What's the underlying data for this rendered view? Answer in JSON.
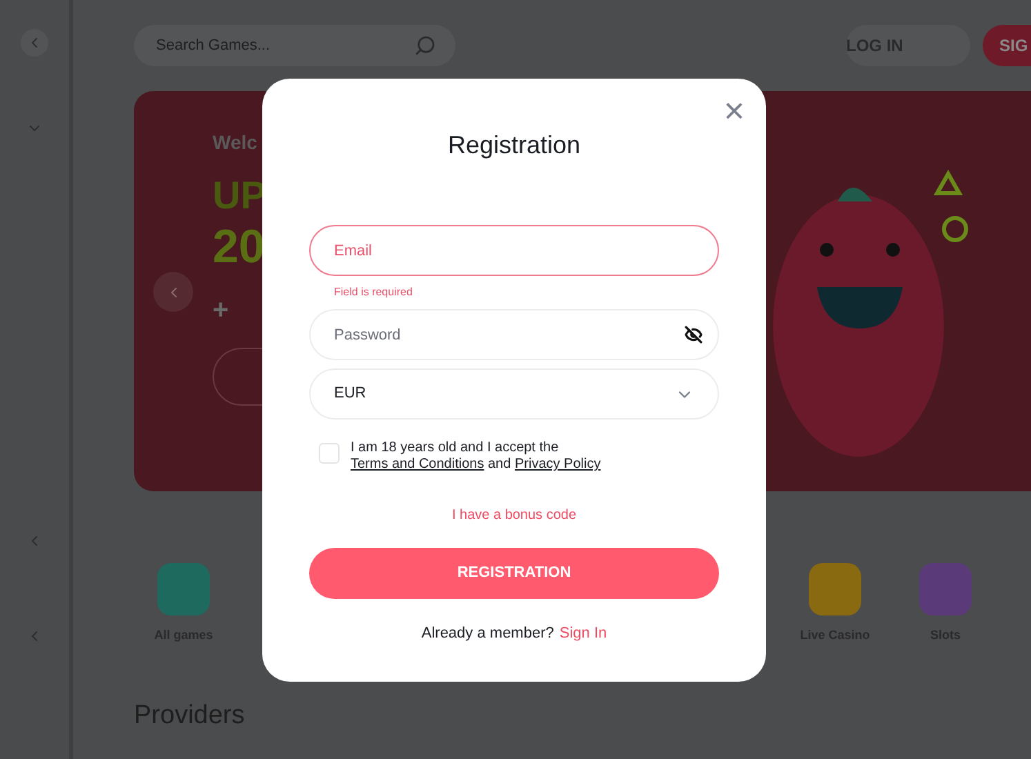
{
  "search": {
    "placeholder": "Search Games..."
  },
  "header_buttons": [
    {
      "label": "LOG IN",
      "kind": "secondary"
    },
    {
      "label": "SIG",
      "kind": "primary"
    }
  ],
  "banner": {
    "texts": [
      "Welc",
      "UP",
      "20",
      "+"
    ]
  },
  "categories": [
    {
      "label": "All games",
      "color": "#1e6a5e"
    },
    {
      "label": "Live Casino",
      "color": "#8a6a10"
    },
    {
      "label": "Slots",
      "color": "#5a3a78"
    }
  ],
  "providers_heading": "Providers",
  "modal": {
    "title": "Registration",
    "close": "×",
    "fields": [
      {
        "kind": "input",
        "placeholder": "Email",
        "error": true,
        "error_text": "Field is required"
      },
      {
        "kind": "password",
        "placeholder": "Password",
        "error": false
      },
      {
        "kind": "select",
        "value": "EUR",
        "error": false
      }
    ],
    "consent": {
      "checked": false,
      "text_before": "I am 18 years old and I accept the",
      "terms_link": "Terms and Conditions",
      "middle": "and",
      "privacy_link": "Privacy Policy"
    },
    "bonus_link": "I have a bonus code",
    "submit": "REGISTRATION",
    "footer_text": "Already a member?",
    "footer_link": "Sign In"
  }
}
